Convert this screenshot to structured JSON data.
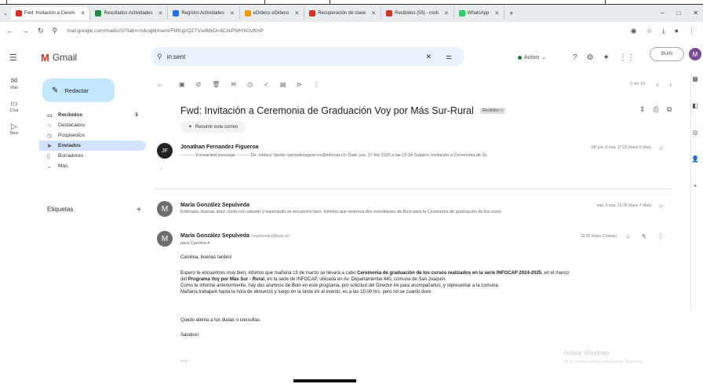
{
  "browser": {
    "tabs": [
      {
        "label": "Fwd: Invitación a Cerem",
        "active": true,
        "color": "#d93025"
      },
      {
        "label": "Resultados Actividades",
        "active": false,
        "color": "#1e8e3e"
      },
      {
        "label": "Registro Actividades",
        "active": false,
        "color": "#1a73e8"
      },
      {
        "label": "eDideco eDideco",
        "active": false,
        "color": "#f29900"
      },
      {
        "label": "Recuperación de clave",
        "active": false,
        "color": "#d93025"
      },
      {
        "label": "Recibidos (55) - mob",
        "active": false,
        "color": "#d93025"
      },
      {
        "label": "WhatsApp",
        "active": false,
        "color": "#25d366"
      }
    ],
    "url": "mail.google.com/mail/u/0/?tab=rm&ogbl#sent/FMfcgzQZTVsdMxDndCzkPWHXGvftmP",
    "window_controls": [
      "–",
      "□",
      "✕"
    ]
  },
  "header": {
    "app_name": "Gmail",
    "search_value": "in:sent",
    "status_label": "Activo",
    "brand_label": "BUIN",
    "avatar_letter": "M"
  },
  "rail": [
    {
      "label": "Mail",
      "icon": "mail-icon"
    },
    {
      "label": "Chat",
      "icon": "chat-icon"
    },
    {
      "label": "Meet",
      "icon": "meet-icon"
    }
  ],
  "sidebar": {
    "compose_label": "Redactar",
    "folders": [
      {
        "label": "Recibidos",
        "count": "5",
        "icon": "inbox-icon",
        "glyph": "▭",
        "active": false,
        "bold": true
      },
      {
        "label": "Destacados",
        "count": "",
        "icon": "star-icon",
        "glyph": "☆",
        "active": false,
        "bold": false
      },
      {
        "label": "Pospuestos",
        "count": "",
        "icon": "clock-icon",
        "glyph": "◷",
        "active": false,
        "bold": false
      },
      {
        "label": "Enviados",
        "count": "",
        "icon": "send-icon",
        "glyph": "➤",
        "active": true,
        "bold": true
      },
      {
        "label": "Borradores",
        "count": "",
        "icon": "draft-icon",
        "glyph": "▯",
        "active": false,
        "bold": false
      },
      {
        "label": "Más",
        "count": "",
        "icon": "chevron-down-icon",
        "glyph": "⌄",
        "active": false,
        "bold": false
      }
    ],
    "labels_title": "Etiquetas"
  },
  "thread": {
    "pager": "2 de 10",
    "subject": "Fwd: Invitación a Ceremonia de Graduación Voy por Más Sur-Rural",
    "subject_tag": "Recibidos ×",
    "summarize_label": "Resumir este correo",
    "messages": [
      {
        "sender": "Jonathan Fernandez Figueroa",
        "date": "6P, jue, 6 mar, 17:22 (hace 6 días)",
        "preview": "---------- Forwarded message --------- De: Isidora Varela <periodistagore.ex@infocap.cl> Date: jue, 27 feb 2025 a las 12:34 Subject: Invitación a Ceremonia de Gr",
        "avatar": "JF"
      },
      {
        "sender": "Maria González Sepulveda",
        "date": "mié, 5 mar, 10:16 (hace 7 días)",
        "preview": "Estimada, buenas días! Junto con saludar y esperando se encuentre bien. Informo que tenemos dos estudiantes de Buin para la Ceremonia de graduación de los curso",
        "avatar": "M"
      },
      {
        "sender": "Maria González Sepulveda",
        "email": "<mgonzalez@buin.cl>",
        "date": "13:36 (hace 2 horas)",
        "to": "para Carolina ▾",
        "avatar": "M",
        "greeting": "Carolina, buenas tardes!",
        "body1_pre": "Espero te encuentres muy bien, informo que mañana 13 de marzo se llevará a cabo ",
        "body1_bold": "Ceremonia de graduación de los cursos realizados en la serie INFOCAP 2024-2025",
        "body1_post": ", en el marco",
        "body2_pre": "del ",
        "body2_bold": "Programa Voy por Más Sur - Rural",
        "body2_post": ", en la sede de INFOCAP, ubicada en Av. Departamental 440, comuna de San Joaquín.",
        "body3": "Como te informé anteriormente, hay dos alumnos de Buin en este programa, por solicitud del Director iré para acompañarlos, y representar a la comuna.",
        "body4": "Mañana trabajaré hasta la hora de almuerzo y luego en la tarde iré al evento, es a las 15:00 hrs, pero no se cuanto dure.",
        "closing": "Quedo atenta a tus dudas o consultas.",
        "signoff": "Saludos!"
      }
    ]
  },
  "watermark": {
    "title": "Activar Windows",
    "subtitle": "Ve a Configuración para activar Windows."
  }
}
